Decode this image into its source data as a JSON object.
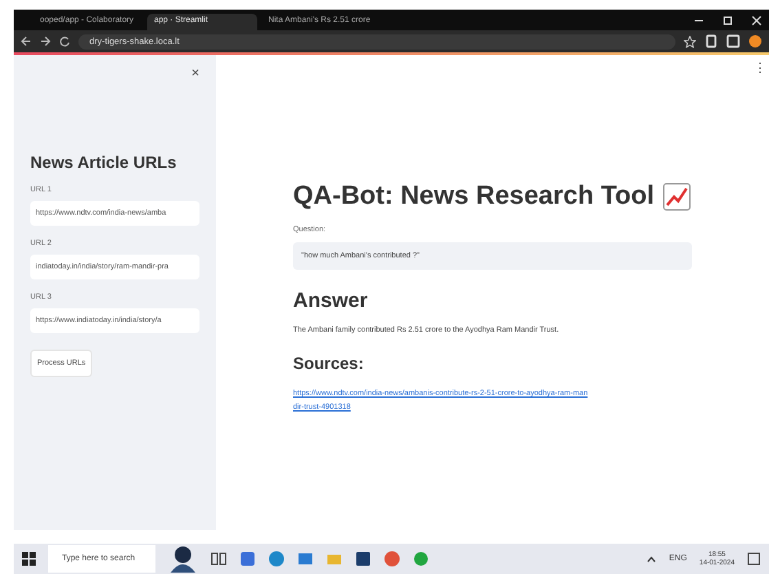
{
  "browser": {
    "tabs": [
      {
        "title": "ooped/app - Colaboratory",
        "selected": false
      },
      {
        "title": "app · Streamlit",
        "selected": true
      },
      {
        "title": "Nita Ambani's Rs 2.51 crore",
        "selected": false
      }
    ],
    "url": "dry-tigers-shake.loca.lt"
  },
  "sidebar": {
    "close": "×",
    "title": "News Article URLs",
    "fields": [
      {
        "label": "URL 1",
        "value": "https://www.ndtv.com/india-news/amba"
      },
      {
        "label": "URL 2",
        "value": "indiatoday.in/india/story/ram-mandir-pra"
      },
      {
        "label": "URL 3",
        "value": "https://www.indiatoday.in/india/story/a"
      }
    ],
    "button": "Process URLs"
  },
  "main": {
    "menu": "⋮",
    "title": "QA-Bot: News Research Tool",
    "question_label": "Question:",
    "question": "\"how much Ambani's contributed ?\"",
    "answer_heading": "Answer",
    "answer": "The Ambani family contributed Rs 2.51 crore to the Ayodhya Ram Mandir Trust.",
    "sources_heading": "Sources:",
    "sources": [
      "https://www.ndtv.com/india-news/ambanis-contribute-rs-2-51-crore-to-ayodhya-ram-mandir-trust-4901318"
    ]
  },
  "taskbar": {
    "search_placeholder": "Type here to search",
    "language": "ENG",
    "time": "18:55",
    "date": "14-01-2024"
  }
}
